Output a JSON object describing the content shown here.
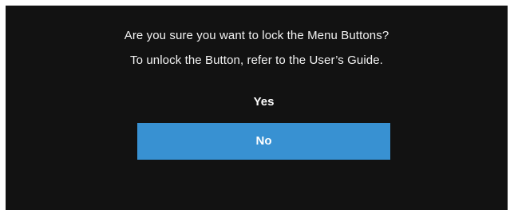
{
  "dialog": {
    "message_line1": "Are you sure you want to lock the Menu Buttons?",
    "message_line2": "To unlock the Button, refer to the User’s Guide.",
    "yes_label": "Yes",
    "no_label": "No",
    "selected_option": "No",
    "colors": {
      "background": "#121212",
      "text": "#f2f2f2",
      "selected_button": "#3891d2"
    }
  }
}
